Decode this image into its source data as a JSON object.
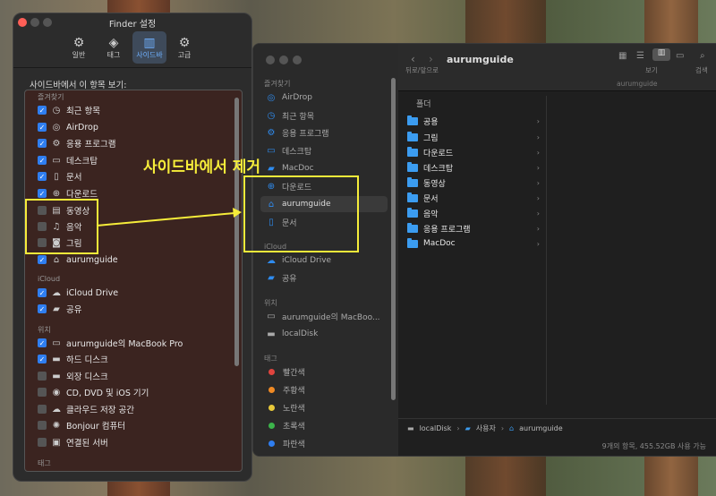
{
  "settings": {
    "title": "Finder 설정",
    "tabs": [
      {
        "label": "일반",
        "icon": "gear-icon"
      },
      {
        "label": "태그",
        "icon": "tag-icon"
      },
      {
        "label": "사이드바",
        "icon": "sidebar-icon"
      },
      {
        "label": "고급",
        "icon": "advanced-gear-icon"
      }
    ],
    "caption": "사이드바에서 이 항목 보기:",
    "sections": {
      "favorites": "즐겨찾기",
      "icloud": "iCloud",
      "locations": "위치",
      "tags": "태그"
    },
    "favorites": [
      {
        "label": "최근 항목",
        "checked": true,
        "icon": "clock-icon"
      },
      {
        "label": "AirDrop",
        "checked": true,
        "icon": "airdrop-icon"
      },
      {
        "label": "응용 프로그램",
        "checked": true,
        "icon": "applications-icon"
      },
      {
        "label": "데스크탑",
        "checked": true,
        "icon": "desktop-icon"
      },
      {
        "label": "문서",
        "checked": true,
        "icon": "document-icon"
      },
      {
        "label": "다운로드",
        "checked": true,
        "icon": "download-icon"
      },
      {
        "label": "동영상",
        "checked": false,
        "icon": "film-icon"
      },
      {
        "label": "음악",
        "checked": false,
        "icon": "music-icon"
      },
      {
        "label": "그림",
        "checked": false,
        "icon": "camera-icon"
      },
      {
        "label": "aurumguide",
        "checked": true,
        "icon": "home-icon"
      }
    ],
    "icloud": [
      {
        "label": "iCloud Drive",
        "checked": true,
        "icon": "cloud-icon"
      },
      {
        "label": "공유",
        "checked": true,
        "icon": "shared-folder-icon"
      }
    ],
    "locations": [
      {
        "label": "aurumguide의 MacBook Pro",
        "checked": true,
        "icon": "laptop-icon"
      },
      {
        "label": "하드 디스크",
        "checked": true,
        "icon": "disk-icon"
      },
      {
        "label": "외장 디스크",
        "checked": false,
        "icon": "disk-icon"
      },
      {
        "label": "CD, DVD 및 iOS 기기",
        "checked": false,
        "icon": "disc-icon"
      },
      {
        "label": "클라우드 저장 공간",
        "checked": false,
        "icon": "cloud-icon"
      },
      {
        "label": "Bonjour 컴퓨터",
        "checked": false,
        "icon": "bonjour-icon"
      },
      {
        "label": "연결된 서버",
        "checked": false,
        "icon": "server-icon"
      }
    ]
  },
  "finder": {
    "title": "aurumguide",
    "nav_label": "뒤로/앞으로",
    "view_label": "보기",
    "search_label": "검색",
    "subtitle": "aurumguide",
    "sidebar": {
      "favorites_header": "즐겨찾기",
      "favorites": [
        {
          "label": "AirDrop",
          "icon": "airdrop-icon"
        },
        {
          "label": "최근 항목",
          "icon": "clock-icon"
        },
        {
          "label": "응용 프로그램",
          "icon": "applications-icon"
        },
        {
          "label": "데스크탑",
          "icon": "desktop-icon"
        },
        {
          "label": "MacDoc",
          "icon": "folder-icon"
        },
        {
          "label": "다운로드",
          "icon": "download-icon"
        },
        {
          "label": "aurumguide",
          "icon": "home-icon",
          "selected": true
        },
        {
          "label": "문서",
          "icon": "document-icon"
        }
      ],
      "icloud_header": "iCloud",
      "icloud": [
        {
          "label": "iCloud Drive",
          "icon": "cloud-icon"
        },
        {
          "label": "공유",
          "icon": "shared-folder-icon"
        }
      ],
      "locations_header": "위치",
      "locations": [
        {
          "label": "aurumguide의 MacBoo...",
          "icon": "laptop-icon"
        },
        {
          "label": "localDisk",
          "icon": "disk-icon"
        }
      ],
      "tags_header": "태그",
      "tags": [
        {
          "label": "빨간색",
          "color": "#e0443e"
        },
        {
          "label": "주황색",
          "color": "#f08a24"
        },
        {
          "label": "노란색",
          "color": "#e8c93a"
        },
        {
          "label": "초록색",
          "color": "#3cb44b"
        },
        {
          "label": "파란색",
          "color": "#2f7ef0"
        }
      ]
    },
    "column_header": "폴더",
    "folders": [
      "공용",
      "그림",
      "다운로드",
      "데스크탑",
      "동영상",
      "문서",
      "음악",
      "응용 프로그램",
      "MacDoc"
    ],
    "path": [
      "localDisk",
      "사용자",
      "aurumguide"
    ],
    "status": "9개의 항목, 455.52GB 사용 가능"
  },
  "annotation": {
    "text": "사이드바에서  제거",
    "color": "#f6ed3a"
  }
}
